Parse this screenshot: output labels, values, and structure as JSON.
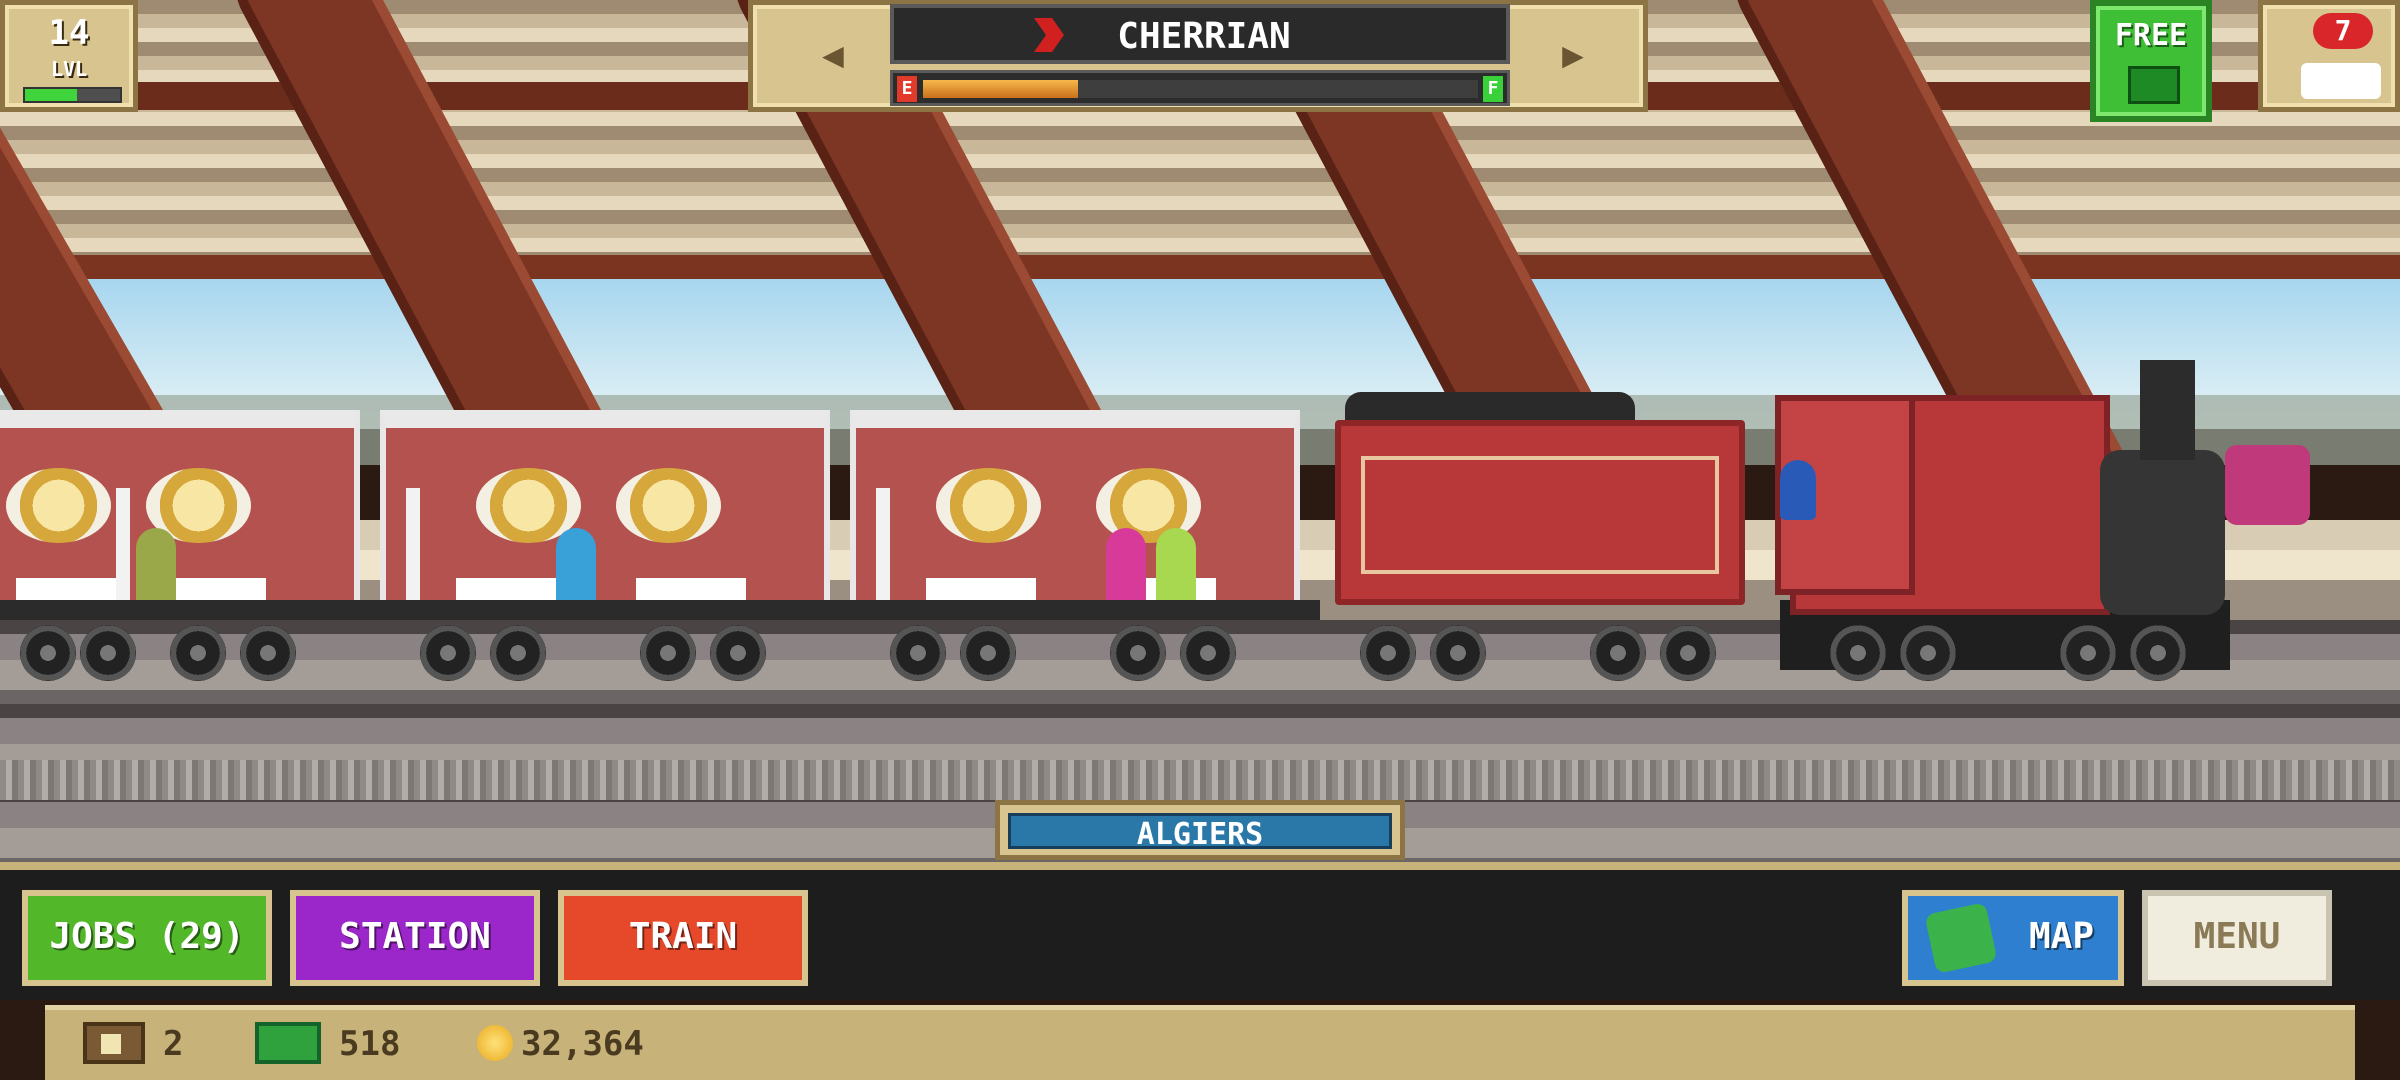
{
  "player": {
    "level": "14",
    "level_label": "LVL",
    "xp_fraction": 0.55
  },
  "train": {
    "name": "CHERRIAN",
    "fuel_empty_label": "E",
    "fuel_full_label": "F",
    "fuel_fraction": 0.28
  },
  "top_right": {
    "free_label": "FREE",
    "notification_count": "7"
  },
  "station": {
    "name": "ALGIERS"
  },
  "buttons": {
    "jobs": "JOBS (29)",
    "station": "STATION",
    "train": "TRAIN",
    "map": "MAP",
    "menu": "MENU"
  },
  "resources": {
    "crates": "2",
    "cash": "518",
    "coins": "32,364"
  },
  "icons": {
    "prev": "left-arrow-icon",
    "next": "right-arrow-icon",
    "flag": "train-flag-icon",
    "crate": "crate-icon",
    "cash": "cash-icon",
    "coin": "coin-icon",
    "map": "map-icon"
  },
  "colors": {
    "jobs": "#52b82a",
    "station": "#9b26c9",
    "train": "#e6482a",
    "map": "#2e7fd0",
    "free": "#3fbf35"
  }
}
